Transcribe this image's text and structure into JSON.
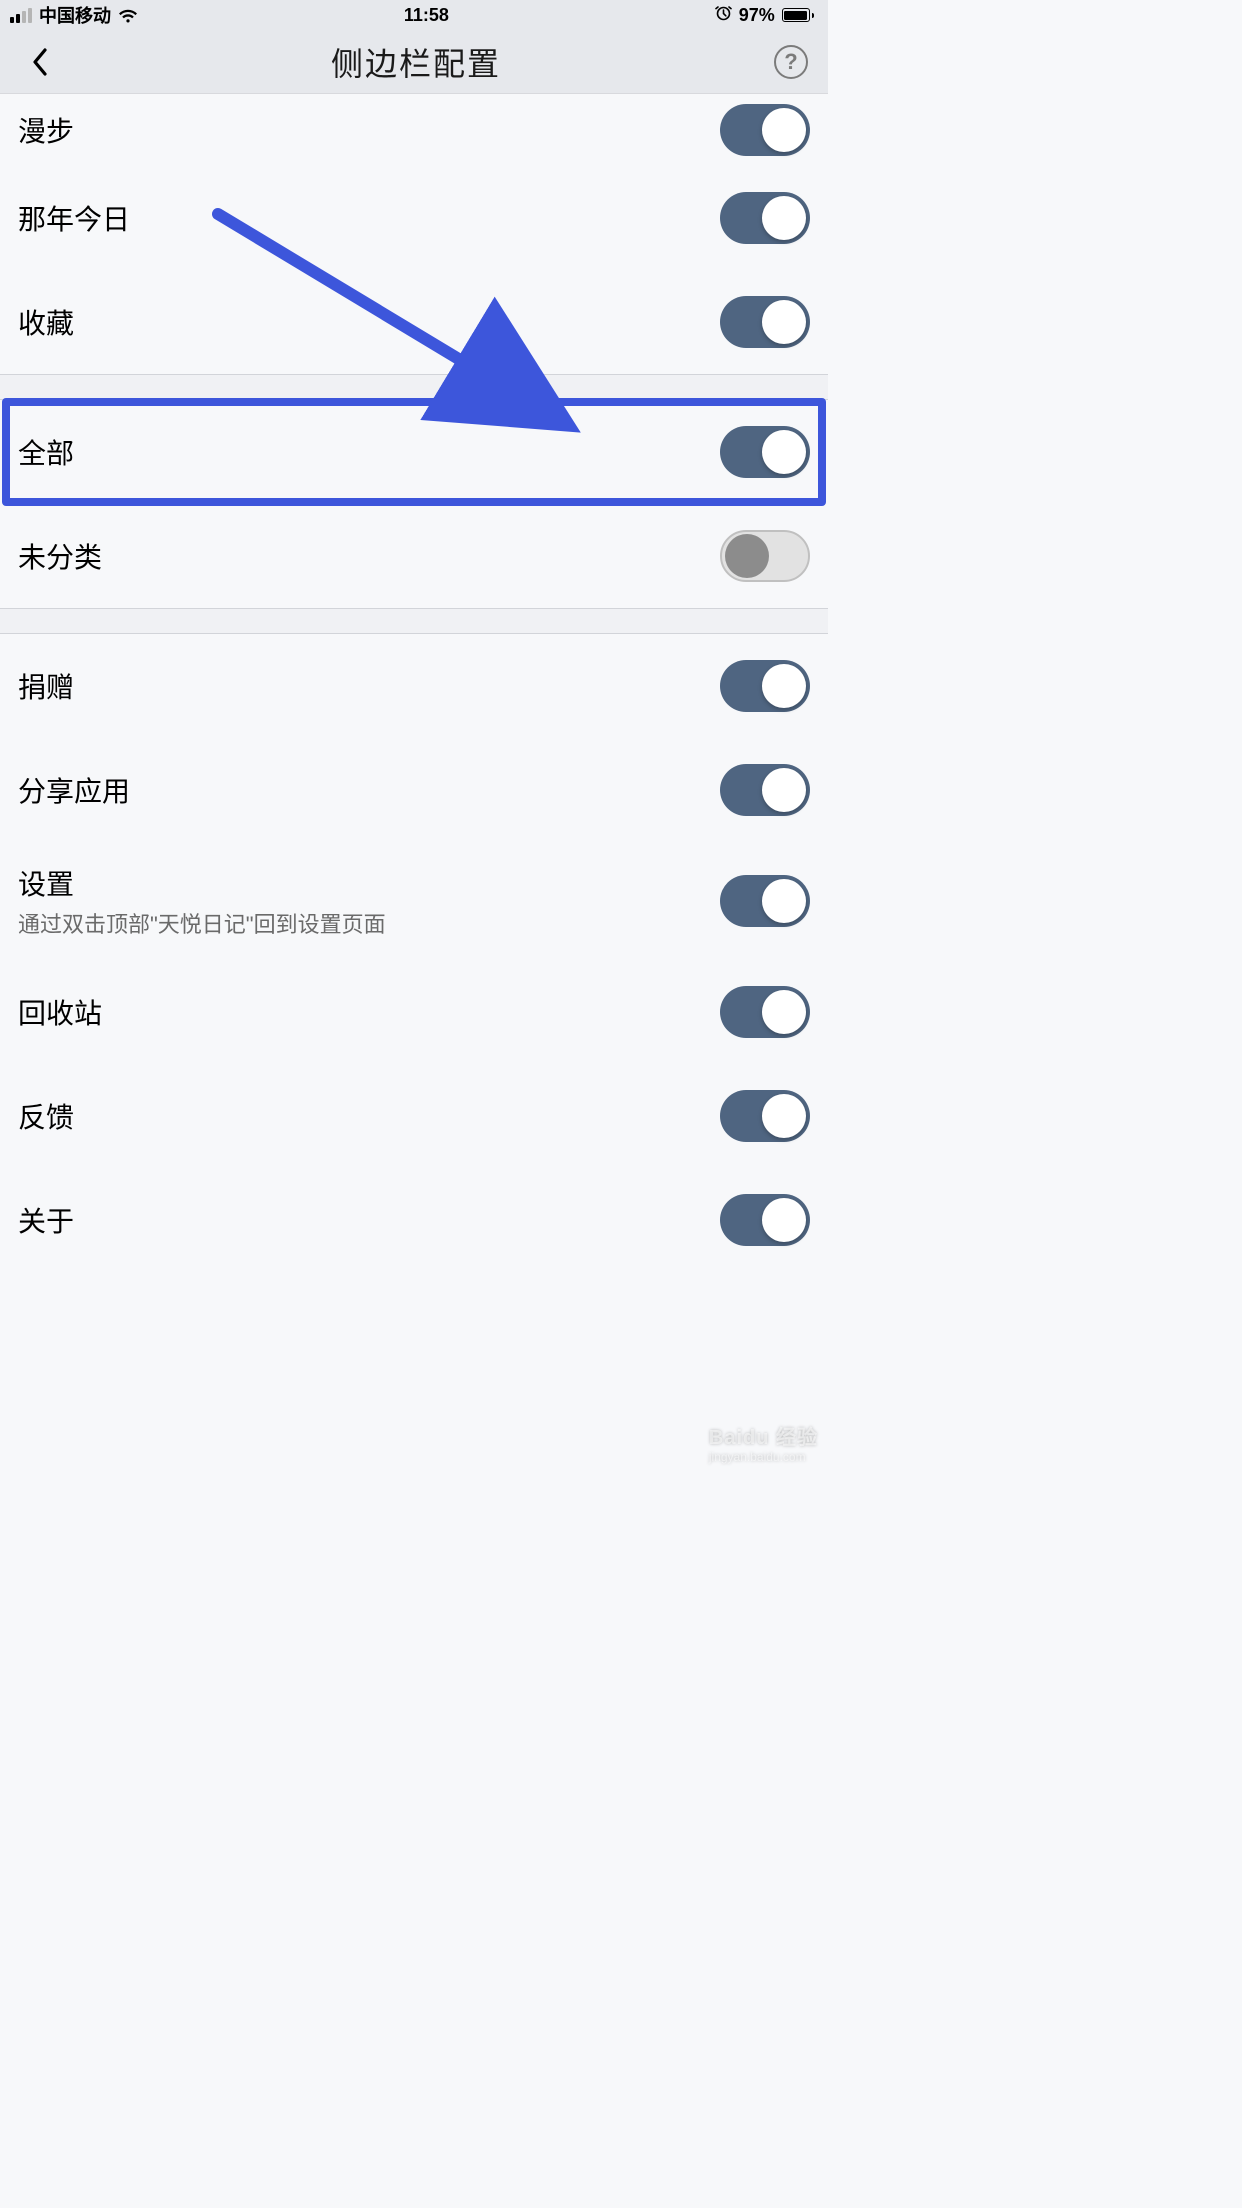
{
  "status_bar": {
    "carrier": "中国移动",
    "time": "11:58",
    "battery_pct": "97%"
  },
  "nav": {
    "title": "侧边栏配置",
    "help_glyph": "?"
  },
  "sections": [
    {
      "rows": [
        {
          "label": "漫步",
          "on": true
        },
        {
          "label": "那年今日",
          "on": true
        },
        {
          "label": "收藏",
          "on": true
        }
      ]
    },
    {
      "rows": [
        {
          "label": "全部",
          "on": true,
          "highlighted": true
        },
        {
          "label": "未分类",
          "on": false
        }
      ]
    },
    {
      "rows": [
        {
          "label": "捐赠",
          "on": true
        },
        {
          "label": "分享应用",
          "on": true
        },
        {
          "label": "设置",
          "sub": "通过双击顶部\"天悦日记\"回到设置页面",
          "on": true
        },
        {
          "label": "回收站",
          "on": true
        },
        {
          "label": "反馈",
          "on": true
        },
        {
          "label": "关于",
          "on": true
        }
      ]
    }
  ],
  "annotation": {
    "highlight_row_label": "全部",
    "arrow_color": "#3d56db"
  },
  "watermark": {
    "main": "Baidu 经验",
    "sub": "jingyan.baidu.com"
  }
}
